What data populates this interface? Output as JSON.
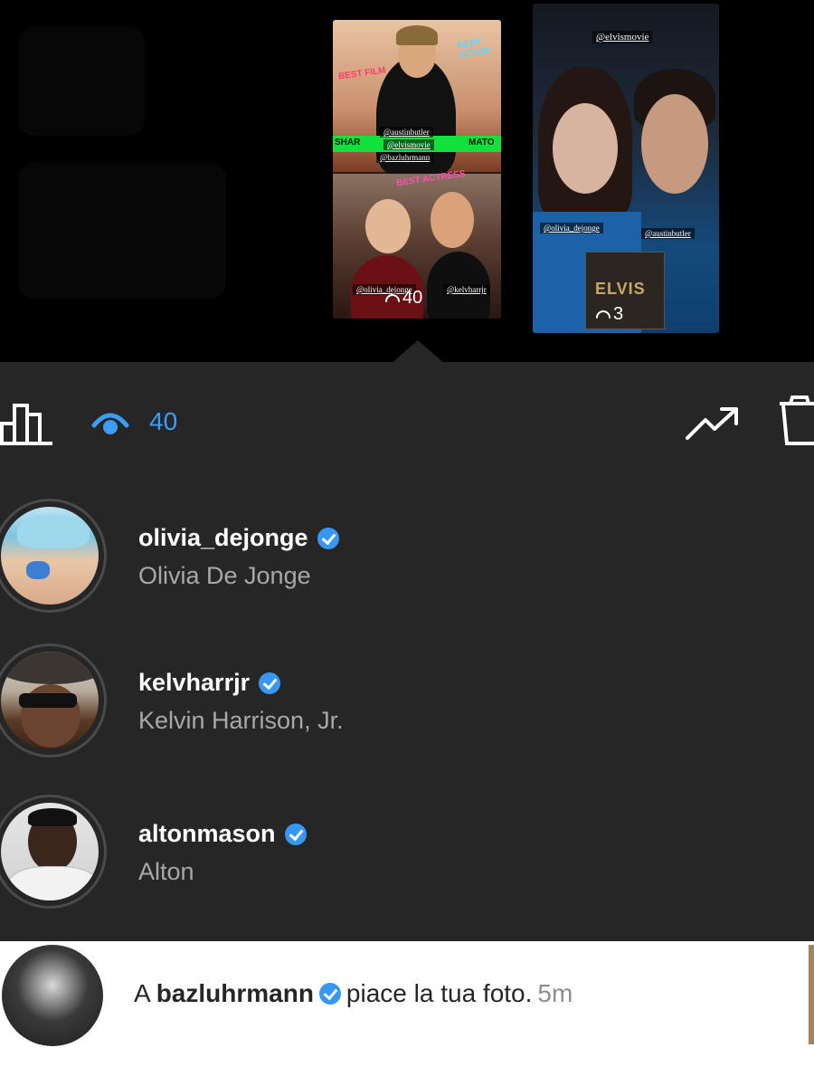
{
  "stories": [
    {
      "tags": [
        "@austinbutler",
        "@elvismovie",
        "@bazluhrmann",
        "@olivia_dejonge",
        "@kelvharrjr"
      ],
      "stickers": [
        "BEST FILM",
        "BEST ACTOR",
        "SHAR",
        "MATO",
        "BEST ACTRESS"
      ],
      "views": "40"
    },
    {
      "tags": [
        "@elvismovie",
        "@olivia_dejonge",
        "@austinbutler"
      ],
      "poster_text": "ELVIS",
      "views": "3"
    }
  ],
  "toolbar": {
    "insights_icon": "bar-chart-icon",
    "views_icon": "eye-icon",
    "views_count": "40",
    "promote_icon": "trending-up-icon",
    "delete_icon": "trash-icon",
    "accent": "#3d9df6"
  },
  "viewers": [
    {
      "username": "olivia_dejonge",
      "full_name": "Olivia De Jonge",
      "verified": true
    },
    {
      "username": "kelvharrjr",
      "full_name": "Kelvin Harrison, Jr.",
      "verified": true
    },
    {
      "username": "altonmason",
      "full_name": "Alton",
      "verified": true
    }
  ],
  "notification": {
    "prefix": "A",
    "username": "bazluhrmann",
    "message": "piace la tua foto.",
    "time": "5m"
  },
  "colors": {
    "panel_bg": "#262626",
    "verified": "#3897f0",
    "secondary_text": "#a8a8a8"
  }
}
